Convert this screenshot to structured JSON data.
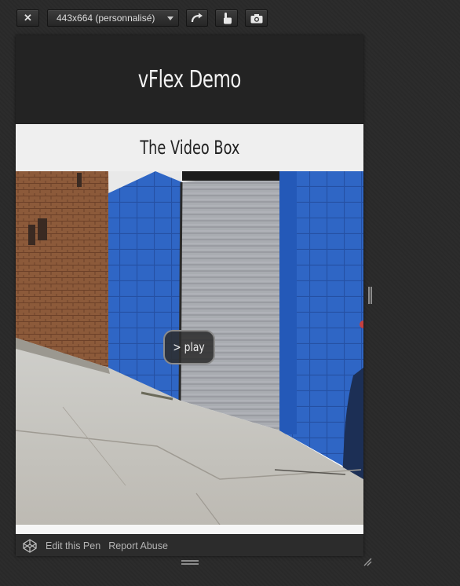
{
  "toolbar": {
    "close_icon": "close-icon",
    "size_label": "443x664 (personnalisé)",
    "rotate_icon": "rotate-icon",
    "touch_icon": "touch-icon",
    "screenshot_icon": "camera-icon"
  },
  "app": {
    "title": "vFlex Demo",
    "section_title": "The Video Box",
    "play_label": "> play"
  },
  "footer": {
    "logo_icon": "codepen-icon",
    "edit_link": "Edit this Pen",
    "report_link": "Report Abuse"
  },
  "colors": {
    "background": "#2a2a2a",
    "header": "#232323",
    "section_bar": "#efefef",
    "footer": "#2c2c2c",
    "wall_blue": "#2f66c5"
  }
}
